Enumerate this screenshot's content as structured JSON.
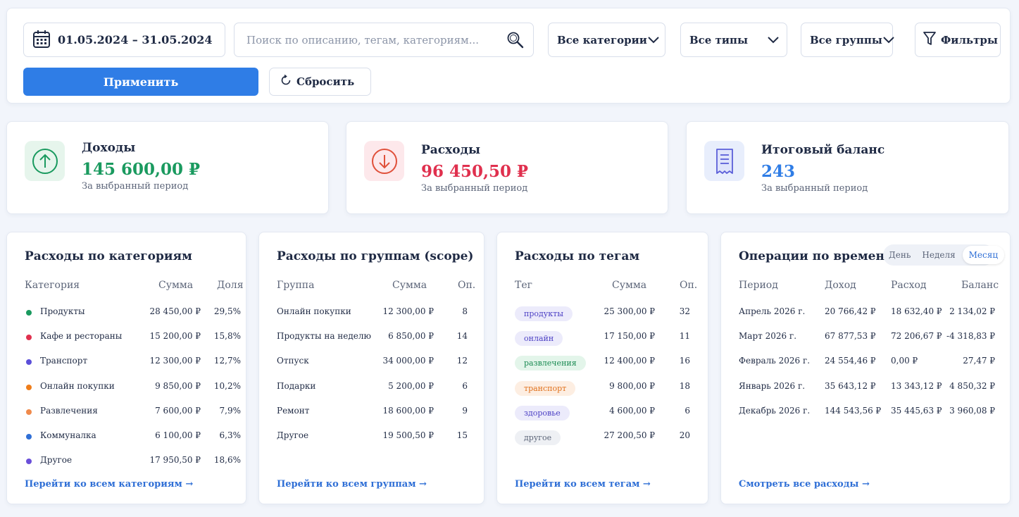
{
  "filters": {
    "date_range": "01.05.2024 – 31.05.2024",
    "search_placeholder": "Поиск по описанию, тегам, категориям...",
    "categories": "Все категории",
    "types": "Все типы",
    "groups": "Все группы",
    "filters_label": "Фильтры",
    "apply_label": "Применить",
    "reset_label": "Сбросить"
  },
  "summary": {
    "income": {
      "title": "Доходы",
      "amount": "145 600,00 ₽",
      "note": "За выбранный период",
      "color": "#1a9a5f"
    },
    "expense": {
      "title": "Расходы",
      "amount": "96 450,50 ₽",
      "note": "За выбранный период",
      "color": "#e0304e"
    },
    "balance": {
      "title": "Итоговый баланс",
      "amount": "243",
      "note": "За выбранный период",
      "color": "#2f7de6"
    }
  },
  "categories_panel": {
    "title": "Расходы по категориям",
    "columns": [
      "Категория",
      "Сумма",
      "Доля"
    ],
    "rows": [
      {
        "name": "Продукты",
        "sum": "28 450,00 ₽",
        "share": "29,5%",
        "color": "#1a9a5f"
      },
      {
        "name": "Кафе и рестораны",
        "sum": "15 200,00 ₽",
        "share": "15,8%",
        "color": "#e0304e"
      },
      {
        "name": "Транспорт",
        "sum": "12 300,00 ₽",
        "share": "12,7%",
        "color": "#5b4fd9"
      },
      {
        "name": "Онлайн покупки",
        "sum": "9 850,00 ₽",
        "share": "10,2%",
        "color": "#ef7d1a"
      },
      {
        "name": "Развлечения",
        "sum": "7 600,00 ₽",
        "share": "7,9%",
        "color": "#f08a4b"
      },
      {
        "name": "Коммуналка",
        "sum": "6 100,00 ₽",
        "share": "6,3%",
        "color": "#2f6fd6"
      },
      {
        "name": "Другое",
        "sum": "17 950,50 ₽",
        "share": "18,6%",
        "color": "#6a4fd9"
      }
    ],
    "link": "Перейти ко всем категориям →"
  },
  "groups_panel": {
    "title": "Расходы по группам (scope)",
    "columns": [
      "Группа",
      "Сумма",
      "Оп."
    ],
    "rows": [
      {
        "name": "Онлайн покупки",
        "sum": "12 300,00 ₽",
        "ops": "8"
      },
      {
        "name": "Продукты на неделю",
        "sum": "6 850,00 ₽",
        "ops": "14"
      },
      {
        "name": "Отпуск",
        "sum": "34 000,00 ₽",
        "ops": "12"
      },
      {
        "name": "Подарки",
        "sum": "5 200,00 ₽",
        "ops": "6"
      },
      {
        "name": "Ремонт",
        "sum": "18 600,00 ₽",
        "ops": "9"
      },
      {
        "name": "Другое",
        "sum": "19 500,50 ₽",
        "ops": "15"
      }
    ],
    "link": "Перейти ко всем группам →"
  },
  "tags_panel": {
    "title": "Расходы по тегам",
    "columns": [
      "Тег",
      "Сумма",
      "Оп."
    ],
    "rows": [
      {
        "name": "продукты",
        "sum": "25 300,00 ₽",
        "ops": "32",
        "bg": "#ecebfb",
        "fg": "#4b3fc4"
      },
      {
        "name": "онлайн",
        "sum": "17 150,00 ₽",
        "ops": "11",
        "bg": "#ecebfb",
        "fg": "#4b3fc4"
      },
      {
        "name": "развлечения",
        "sum": "12 400,00 ₽",
        "ops": "16",
        "bg": "#e3f5ea",
        "fg": "#1a8a52"
      },
      {
        "name": "транспорт",
        "sum": "9 800,00 ₽",
        "ops": "18",
        "bg": "#fdeee2",
        "fg": "#e0701a"
      },
      {
        "name": "здоровье",
        "sum": "4 600,00 ₽",
        "ops": "6",
        "bg": "#ecebfb",
        "fg": "#4b3fc4"
      },
      {
        "name": "другое",
        "sum": "27 200,50 ₽",
        "ops": "20",
        "bg": "#eef0f4",
        "fg": "#5b6478"
      }
    ],
    "link": "Перейти ко всем тегам →"
  },
  "time_panel": {
    "title": "Операции по времени",
    "toggle": [
      "День",
      "Неделя",
      "Месяц"
    ],
    "columns": [
      "Период",
      "Доход",
      "Расход",
      "Баланс"
    ],
    "rows": [
      {
        "period": "Апрель 2026 г.",
        "income": "20 766,42 ₽",
        "expense": "18 632,40 ₽",
        "balance": "2 134,02 ₽"
      },
      {
        "period": "Март 2026 г.",
        "income": "67 877,53 ₽",
        "expense": "72 206,67 ₽",
        "balance": "-4 318,83 ₽"
      },
      {
        "period": "Февраль 2026 г.",
        "income": "24 554,46 ₽",
        "expense": "0,00 ₽",
        "balance": "27,47 ₽"
      },
      {
        "period": "Январь 2026 г.",
        "income": "35 643,12 ₽",
        "expense": "13 343,12 ₽",
        "balance": "4 850,32 ₽"
      },
      {
        "period": "Декабрь 2026 г.",
        "income": "144 543,56 ₽",
        "expense": "35 445,63 ₽",
        "balance": "3 960,08 ₽"
      }
    ],
    "link": "Смотреть все расходы →"
  }
}
